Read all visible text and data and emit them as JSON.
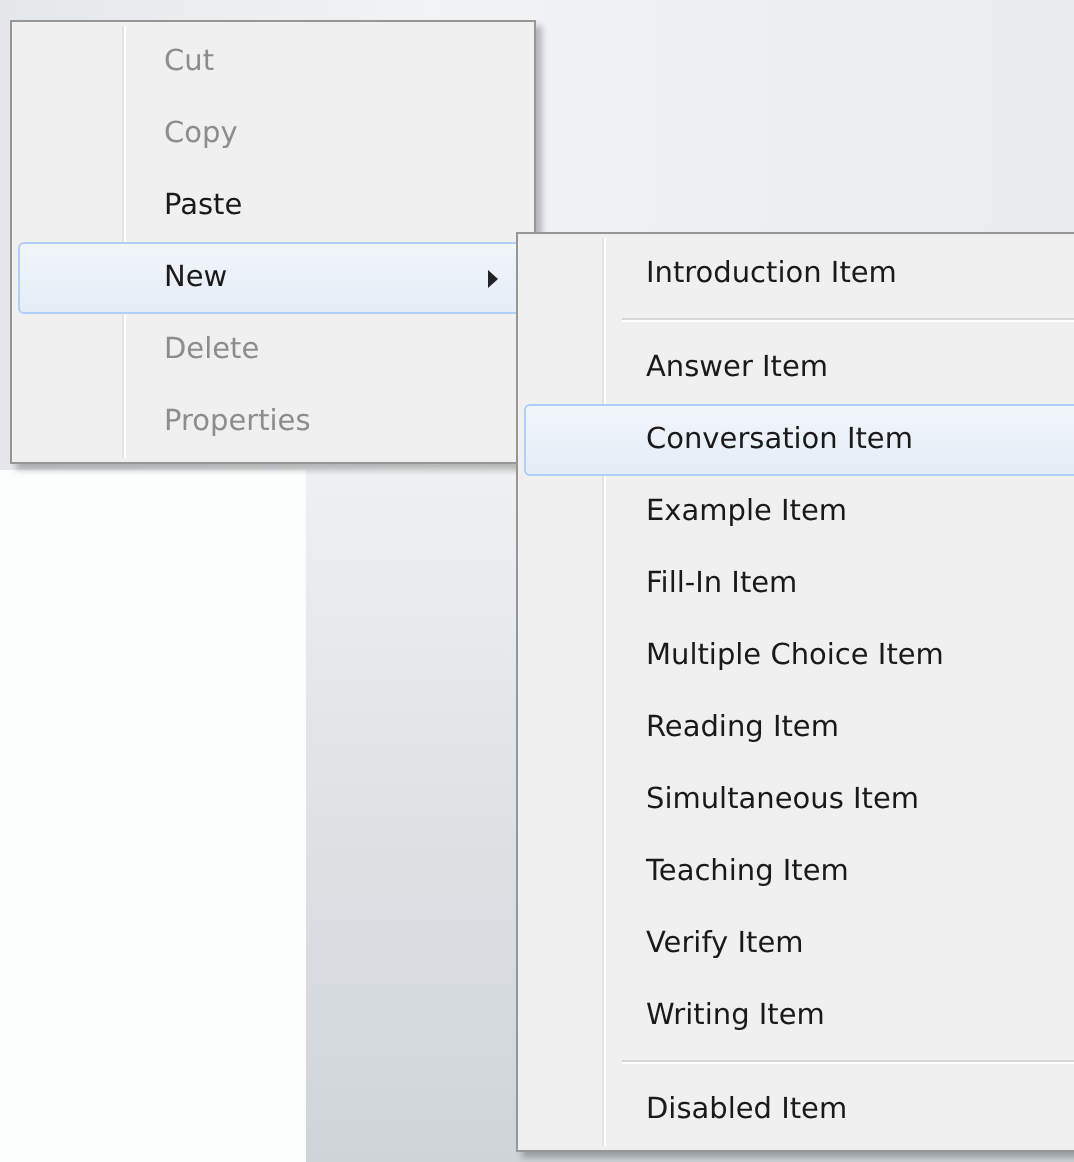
{
  "context_menu": {
    "items": [
      {
        "kind": "item",
        "label": "Cut",
        "disabled": true,
        "selected": false,
        "has_submenu": false
      },
      {
        "kind": "item",
        "label": "Copy",
        "disabled": true,
        "selected": false,
        "has_submenu": false
      },
      {
        "kind": "item",
        "label": "Paste",
        "disabled": false,
        "selected": false,
        "has_submenu": false
      },
      {
        "kind": "item",
        "label": "New",
        "disabled": false,
        "selected": true,
        "has_submenu": true
      },
      {
        "kind": "item",
        "label": "Delete",
        "disabled": true,
        "selected": false,
        "has_submenu": false
      },
      {
        "kind": "item",
        "label": "Properties",
        "disabled": true,
        "selected": false,
        "has_submenu": false
      }
    ]
  },
  "submenu": {
    "items": [
      {
        "kind": "item",
        "label": "Introduction Item",
        "disabled": false,
        "selected": false,
        "has_submenu": false
      },
      {
        "kind": "separator"
      },
      {
        "kind": "item",
        "label": "Answer Item",
        "disabled": false,
        "selected": false,
        "has_submenu": false
      },
      {
        "kind": "item",
        "label": "Conversation Item",
        "disabled": false,
        "selected": true,
        "has_submenu": false
      },
      {
        "kind": "item",
        "label": "Example Item",
        "disabled": false,
        "selected": false,
        "has_submenu": false
      },
      {
        "kind": "item",
        "label": "Fill-In Item",
        "disabled": false,
        "selected": false,
        "has_submenu": false
      },
      {
        "kind": "item",
        "label": "Multiple Choice Item",
        "disabled": false,
        "selected": false,
        "has_submenu": false
      },
      {
        "kind": "item",
        "label": "Reading Item",
        "disabled": false,
        "selected": false,
        "has_submenu": false
      },
      {
        "kind": "item",
        "label": "Simultaneous Item",
        "disabled": false,
        "selected": false,
        "has_submenu": false
      },
      {
        "kind": "item",
        "label": "Teaching Item",
        "disabled": false,
        "selected": false,
        "has_submenu": false
      },
      {
        "kind": "item",
        "label": "Verify Item",
        "disabled": false,
        "selected": false,
        "has_submenu": false
      },
      {
        "kind": "item",
        "label": "Writing Item",
        "disabled": false,
        "selected": false,
        "has_submenu": false
      },
      {
        "kind": "separator"
      },
      {
        "kind": "item",
        "label": "Disabled Item",
        "disabled": false,
        "selected": false,
        "has_submenu": false
      }
    ]
  }
}
